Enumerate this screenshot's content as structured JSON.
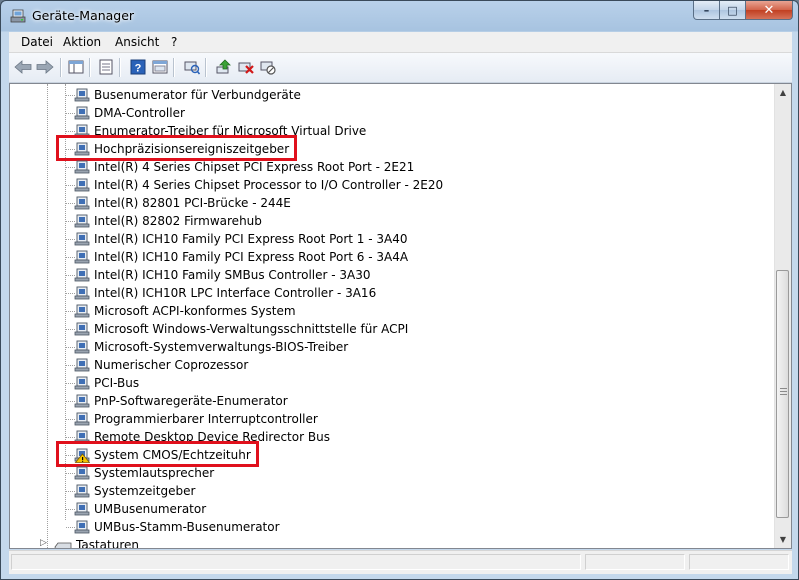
{
  "window": {
    "title": "Geräte-Manager",
    "buttons": {
      "minimize": "–",
      "maximize": "□",
      "close": "✕"
    }
  },
  "menubar": {
    "items": [
      "Datei",
      "Aktion",
      "Ansicht",
      "?"
    ]
  },
  "toolbar": {
    "buttons": [
      "back-icon",
      "forward-icon",
      "tree-view-icon",
      "properties-icon",
      "help-icon",
      "console-icon",
      "scan-hardware-icon",
      "update-driver-icon",
      "uninstall-icon",
      "disable-device-icon"
    ]
  },
  "tree": {
    "devices": [
      "Busenumerator für Verbundgeräte",
      "DMA-Controller",
      "Enumerator-Treiber für Microsoft Virtual Drive",
      "Hochpräzisionsereigniszeitgeber",
      "Intel(R) 4 Series Chipset PCI Express Root Port - 2E21",
      "Intel(R) 4 Series Chipset Processor to I/O Controller - 2E20",
      "Intel(R) 82801 PCI-Brücke - 244E",
      "Intel(R) 82802 Firmwarehub",
      "Intel(R) ICH10 Family PCI Express Root Port 1 - 3A40",
      "Intel(R) ICH10 Family PCI Express Root Port 6 - 3A4A",
      "Intel(R) ICH10 Family SMBus Controller - 3A30",
      "Intel(R) ICH10R LPC Interface Controller - 3A16",
      "Microsoft ACPI-konformes System",
      "Microsoft Windows-Verwaltungsschnittstelle für ACPI",
      "Microsoft-Systemverwaltungs-BIOS-Treiber",
      "Numerischer Coprozessor",
      "PCI-Bus",
      "PnP-Softwaregeräte-Enumerator",
      "Programmierbarer Interruptcontroller",
      "Remote Desktop Device Redirector Bus",
      "System CMOS/Echtzeituhr",
      "Systemlautsprecher",
      "Systemzeitgeber",
      "UMBusenumerator",
      "UMBus-Stamm-Busenumerator"
    ],
    "warning_device": "System CMOS/Echtzeituhr",
    "highlighted": [
      "Hochpräzisionsereigniszeitgeber",
      "System CMOS/Echtzeituhr"
    ],
    "next_category": "Tastaturen"
  },
  "colors": {
    "highlight_border": "#e0101c",
    "warning": "#f5c400"
  }
}
